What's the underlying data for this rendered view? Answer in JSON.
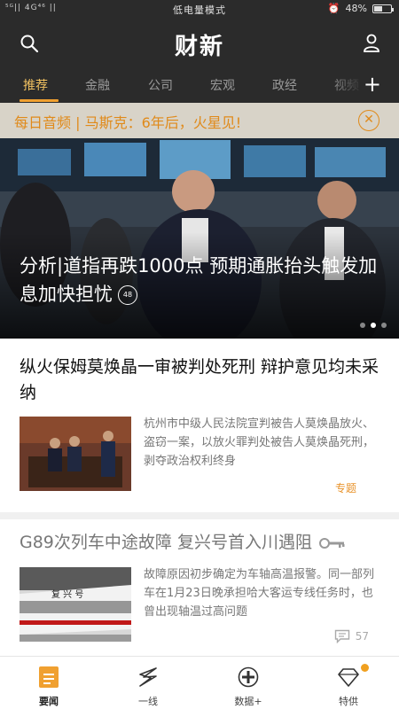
{
  "status_bar": {
    "carrier": "⁵ᴳ|| 4G⁴⁶ ||",
    "mode": "低电量模式",
    "battery": "48%",
    "battery_level": 0.48
  },
  "header": {
    "logo": "财新"
  },
  "tabs": [
    {
      "label": "推荐",
      "active": true
    },
    {
      "label": "金融",
      "active": false
    },
    {
      "label": "公司",
      "active": false
    },
    {
      "label": "宏观",
      "active": false
    },
    {
      "label": "政经",
      "active": false
    },
    {
      "label": "视频",
      "active": false
    }
  ],
  "banner": {
    "text": "每日音频 | 马斯克：6年后，火星见!"
  },
  "hero": {
    "title": "分析|道指再跌1000点 预期通胀抬头触发加息加快担忧",
    "comment_count": "48"
  },
  "articles": [
    {
      "title": "纵火保姆莫焕晶一审被判处死刑 辩护意见均未采纳",
      "summary": "杭州市中级人民法院宣判被告人莫焕晶放火、盗窃一案，以放火罪判处被告人莫焕晶死刑，剥夺政治权利终身",
      "tag": "专题"
    },
    {
      "title": "G89次列车中途故障 复兴号首入川遇阻",
      "summary": "故障原因初步确定为车轴高温报警。同一部列车在1月23日晚承担哈大客运专线任务时，也曾出现轴温过高问题",
      "comments": "57"
    }
  ],
  "bottom_nav": [
    {
      "label": "要闻",
      "icon": "news-icon",
      "active": true
    },
    {
      "label": "一线",
      "icon": "lightning-icon",
      "active": false
    },
    {
      "label": "数据+",
      "icon": "data-icon",
      "active": false
    },
    {
      "label": "特供",
      "icon": "diamond-icon",
      "active": false
    }
  ],
  "colors": {
    "accent": "#f0a030",
    "banner_text": "#e08a1a",
    "header_bg": "#2b2b2b"
  }
}
